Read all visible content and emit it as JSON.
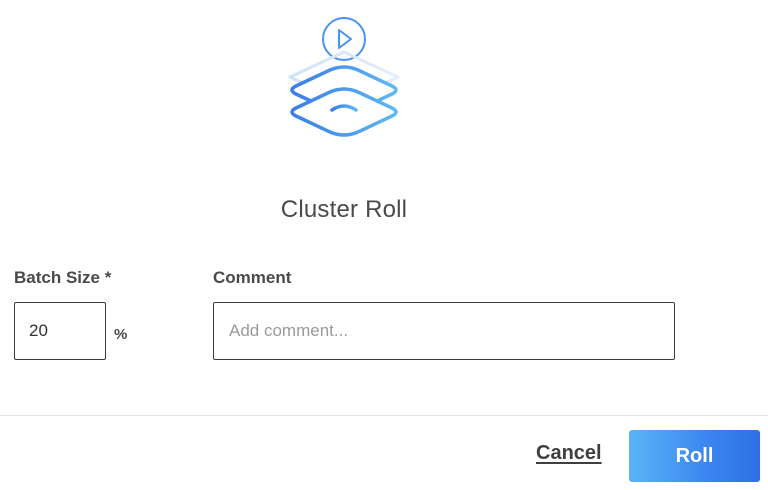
{
  "dialog": {
    "title": "Cluster Roll",
    "icon": "layers-play-icon"
  },
  "form": {
    "batch_size": {
      "label": "Batch Size *",
      "value": "20",
      "unit": "%"
    },
    "comment": {
      "label": "Comment",
      "value": "",
      "placeholder": "Add comment..."
    }
  },
  "footer": {
    "cancel_label": "Cancel",
    "roll_label": "Roll"
  },
  "colors": {
    "accent": "#3a86ef",
    "accent_light": "#5ab4f6"
  }
}
